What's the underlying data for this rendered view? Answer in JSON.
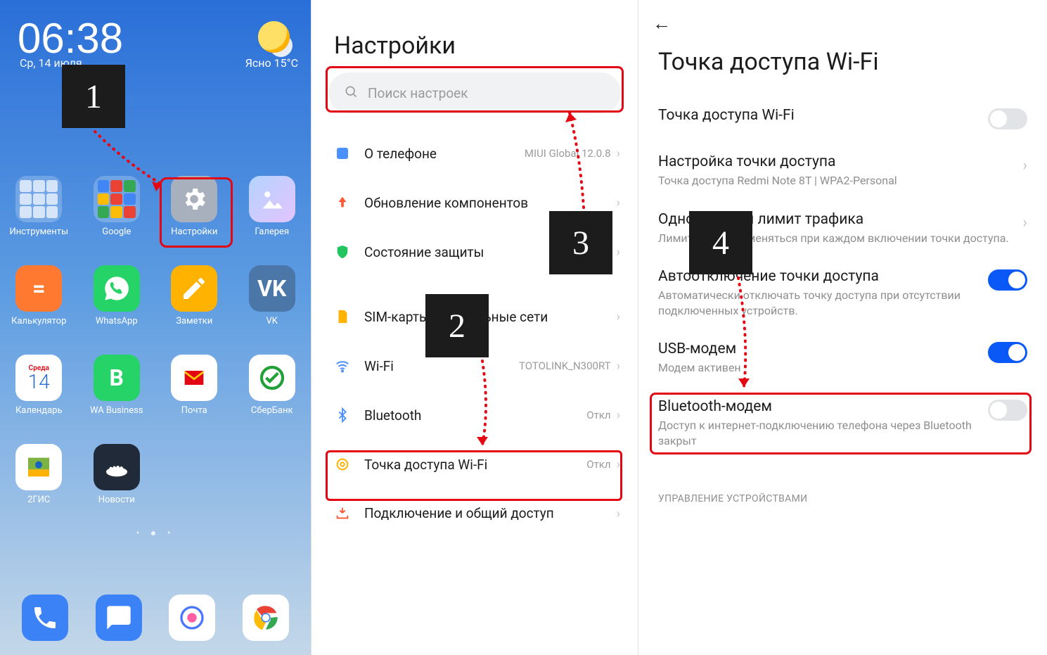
{
  "home": {
    "clock": "06:38",
    "date": "Ср, 14 июля",
    "weather": "Ясно  15°C",
    "apps": [
      {
        "label": "Инструменты"
      },
      {
        "label": "Google"
      },
      {
        "label": "Настройки"
      },
      {
        "label": "Галерея"
      },
      {
        "label": "Калькулятор"
      },
      {
        "label": "WhatsApp"
      },
      {
        "label": "Заметки"
      },
      {
        "label": "VK"
      },
      {
        "label": "Календарь",
        "dow": "Среда",
        "day": "14"
      },
      {
        "label": "WA Business"
      },
      {
        "label": "Почта"
      },
      {
        "label": "СберБанк"
      },
      {
        "label": "2ГИС"
      },
      {
        "label": "Новости"
      }
    ],
    "dock": [
      "Телефон",
      "Сообщения",
      "Камера",
      "Chrome"
    ]
  },
  "settings": {
    "title": "Настройки",
    "search_placeholder": "Поиск настроек",
    "rows": [
      {
        "icon": "about",
        "label": "О телефоне",
        "sub": "MIUI Global 12.0.8"
      },
      {
        "icon": "update",
        "label": "Обновление компонентов",
        "sub": ""
      },
      {
        "icon": "shield",
        "label": "Состояние защиты",
        "sub": ""
      },
      {
        "icon": "sim",
        "label": "SIM-карты и мобильные сети",
        "sub": ""
      },
      {
        "icon": "wifi",
        "label": "Wi-Fi",
        "sub": "TOTOLINK_N300RT"
      },
      {
        "icon": "bt",
        "label": "Bluetooth",
        "sub": "Откл"
      },
      {
        "icon": "hotspot",
        "label": "Точка доступа Wi-Fi",
        "sub": "Откл"
      },
      {
        "icon": "share",
        "label": "Подключение и общий доступ",
        "sub": ""
      }
    ]
  },
  "hotspot": {
    "title": "Точка доступа Wi-Fi",
    "items": [
      {
        "label": "Точка доступа Wi-Fi",
        "desc": "",
        "ctrl": "toggle-off"
      },
      {
        "label": "Настройка точки доступа",
        "desc": "Точка доступа Redmi Note 8T | WPA2-Personal",
        "ctrl": "chev"
      },
      {
        "label": "Однократный лимит трафика",
        "desc": "Лимит будет применяться при каждом включении точки доступа.",
        "ctrl": "chev"
      },
      {
        "label": "Автоотключение точки доступа",
        "desc": "Автоматически отключать точку доступа при отсутствии подключенных устройств.",
        "ctrl": "toggle-on"
      },
      {
        "label": "USB-модем",
        "desc": "Модем активен",
        "ctrl": "toggle-on"
      },
      {
        "label": "Bluetooth-модем",
        "desc": "Доступ к интернет-подключению телефона через Bluetooth закрыт",
        "ctrl": "toggle-off"
      }
    ],
    "section": "УПРАВЛЕНИЕ УСТРОЙСТВАМИ"
  },
  "callouts": [
    "1",
    "2",
    "3",
    "4"
  ]
}
